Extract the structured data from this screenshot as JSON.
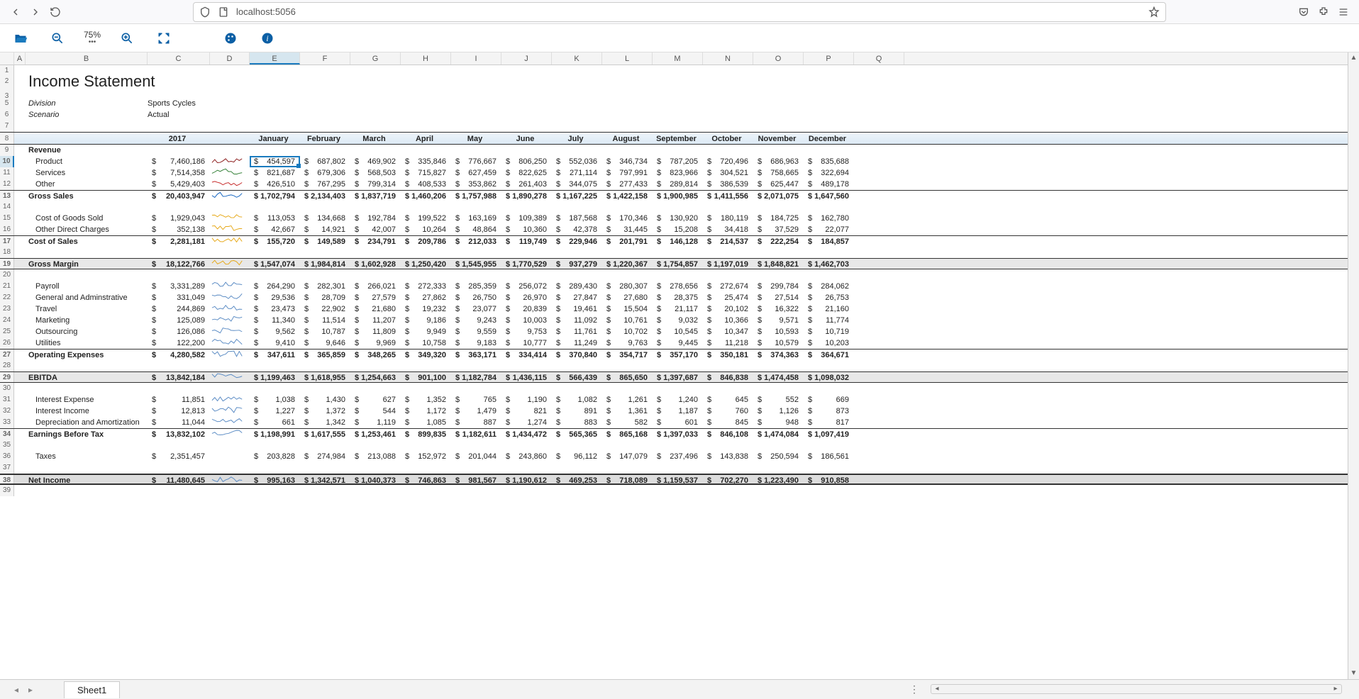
{
  "browser": {
    "url": "localhost:5056"
  },
  "toolbar": {
    "zoom": "75%"
  },
  "bottom": {
    "sheet": "Sheet1"
  },
  "columns_letters": [
    "A",
    "B",
    "C",
    "D",
    "E",
    "F",
    "G",
    "H",
    "I",
    "J",
    "K",
    "L",
    "M",
    "N",
    "O",
    "P",
    "Q"
  ],
  "row_nums": [
    "1",
    "2",
    "3",
    "5",
    "6",
    "7",
    "8",
    "9",
    "10",
    "11",
    "12",
    "13",
    "14",
    "15",
    "16",
    "17",
    "18",
    "19",
    "20",
    "21",
    "22",
    "23",
    "24",
    "25",
    "26",
    "27",
    "28",
    "29",
    "30",
    "31",
    "32",
    "33",
    "34",
    "35",
    "36",
    "37",
    "38",
    "39"
  ],
  "title": "Income Statement",
  "meta": {
    "division_label": "Division",
    "division_value": "Sports Cycles",
    "scenario_label": "Scenario",
    "scenario_value": "Actual"
  },
  "header": {
    "year": "2017",
    "months": [
      "January",
      "February",
      "March",
      "April",
      "May",
      "June",
      "July",
      "August",
      "September",
      "October",
      "November",
      "December"
    ]
  },
  "lines": {
    "revenue_hdr": "Revenue",
    "product": {
      "label": "Product",
      "total": "7,460,186",
      "m": [
        "454,597",
        "687,802",
        "469,902",
        "335,846",
        "776,667",
        "806,250",
        "552,036",
        "346,734",
        "787,205",
        "720,496",
        "686,963",
        "835,688"
      ]
    },
    "services": {
      "label": "Services",
      "total": "7,514,358",
      "m": [
        "821,687",
        "679,306",
        "568,503",
        "715,827",
        "627,459",
        "822,625",
        "271,114",
        "797,991",
        "823,966",
        "304,521",
        "758,665",
        "322,694"
      ]
    },
    "other": {
      "label": "Other",
      "total": "5,429,403",
      "m": [
        "426,510",
        "767,295",
        "799,314",
        "408,533",
        "353,862",
        "261,403",
        "344,075",
        "277,433",
        "289,814",
        "386,539",
        "625,447",
        "489,178"
      ]
    },
    "gross_sales": {
      "label": "Gross Sales",
      "total": "20,403,947",
      "m": [
        "1,702,794",
        "2,134,403",
        "1,837,719",
        "1,460,206",
        "1,757,988",
        "1,890,278",
        "1,167,225",
        "1,422,158",
        "1,900,985",
        "1,411,556",
        "2,071,075",
        "1,647,560"
      ]
    },
    "cogs": {
      "label": "Cost of Goods Sold",
      "total": "1,929,043",
      "m": [
        "113,053",
        "134,668",
        "192,784",
        "199,522",
        "163,169",
        "109,389",
        "187,568",
        "170,346",
        "130,920",
        "180,119",
        "184,725",
        "162,780"
      ]
    },
    "odc": {
      "label": "Other Direct Charges",
      "total": "352,138",
      "m": [
        "42,667",
        "14,921",
        "42,007",
        "10,264",
        "48,864",
        "10,360",
        "42,378",
        "31,445",
        "15,208",
        "34,418",
        "37,529",
        "22,077"
      ]
    },
    "cos": {
      "label": "Cost of Sales",
      "total": "2,281,181",
      "m": [
        "155,720",
        "149,589",
        "234,791",
        "209,786",
        "212,033",
        "119,749",
        "229,946",
        "201,791",
        "146,128",
        "214,537",
        "222,254",
        "184,857"
      ]
    },
    "gm": {
      "label": "Gross Margin",
      "total": "18,122,766",
      "m": [
        "1,547,074",
        "1,984,814",
        "1,602,928",
        "1,250,420",
        "1,545,955",
        "1,770,529",
        "937,279",
        "1,220,367",
        "1,754,857",
        "1,197,019",
        "1,848,821",
        "1,462,703"
      ]
    },
    "payroll": {
      "label": "Payroll",
      "total": "3,331,289",
      "m": [
        "264,290",
        "282,301",
        "266,021",
        "272,333",
        "285,359",
        "256,072",
        "289,430",
        "280,307",
        "278,656",
        "272,674",
        "299,784",
        "284,062"
      ]
    },
    "ga": {
      "label": "General and Adminstrative",
      "total": "331,049",
      "m": [
        "29,536",
        "28,709",
        "27,579",
        "27,862",
        "26,750",
        "26,970",
        "27,847",
        "27,680",
        "28,375",
        "25,474",
        "27,514",
        "26,753"
      ]
    },
    "travel": {
      "label": "Travel",
      "total": "244,869",
      "m": [
        "23,473",
        "22,902",
        "21,680",
        "19,232",
        "23,077",
        "20,839",
        "19,461",
        "15,504",
        "21,117",
        "20,102",
        "16,322",
        "21,160"
      ]
    },
    "mkt": {
      "label": "Marketing",
      "total": "125,089",
      "m": [
        "11,340",
        "11,514",
        "11,207",
        "9,186",
        "9,243",
        "10,003",
        "11,092",
        "10,761",
        "9,032",
        "10,366",
        "9,571",
        "11,774"
      ]
    },
    "out": {
      "label": "Outsourcing",
      "total": "126,086",
      "m": [
        "9,562",
        "10,787",
        "11,809",
        "9,949",
        "9,559",
        "9,753",
        "11,761",
        "10,702",
        "10,545",
        "10,347",
        "10,593",
        "10,719"
      ]
    },
    "util": {
      "label": "Utilities",
      "total": "122,200",
      "m": [
        "9,410",
        "9,646",
        "9,969",
        "10,758",
        "9,183",
        "10,777",
        "11,249",
        "9,763",
        "9,445",
        "11,218",
        "10,579",
        "10,203"
      ]
    },
    "opex": {
      "label": "Operating Expenses",
      "total": "4,280,582",
      "m": [
        "347,611",
        "365,859",
        "348,265",
        "349,320",
        "363,171",
        "334,414",
        "370,840",
        "354,717",
        "357,170",
        "350,181",
        "374,363",
        "364,671"
      ]
    },
    "ebitda": {
      "label": "EBITDA",
      "total": "13,842,184",
      "m": [
        "1,199,463",
        "1,618,955",
        "1,254,663",
        "901,100",
        "1,182,784",
        "1,436,115",
        "566,439",
        "865,650",
        "1,397,687",
        "846,838",
        "1,474,458",
        "1,098,032"
      ]
    },
    "intexp": {
      "label": "Interest Expense",
      "total": "11,851",
      "m": [
        "1,038",
        "1,430",
        "627",
        "1,352",
        "765",
        "1,190",
        "1,082",
        "1,261",
        "1,240",
        "645",
        "552",
        "669"
      ]
    },
    "intinc": {
      "label": "Interest Income",
      "total": "12,813",
      "m": [
        "1,227",
        "1,372",
        "544",
        "1,172",
        "1,479",
        "821",
        "891",
        "1,361",
        "1,187",
        "760",
        "1,126",
        "873"
      ]
    },
    "da": {
      "label": "Depreciation and Amortization",
      "total": "11,044",
      "m": [
        "661",
        "1,342",
        "1,119",
        "1,085",
        "887",
        "1,274",
        "883",
        "582",
        "601",
        "845",
        "948",
        "817"
      ]
    },
    "ebt": {
      "label": "Earnings Before Tax",
      "total": "13,832,102",
      "m": [
        "1,198,991",
        "1,617,555",
        "1,253,461",
        "899,835",
        "1,182,611",
        "1,434,472",
        "565,365",
        "865,168",
        "1,397,033",
        "846,108",
        "1,474,084",
        "1,097,419"
      ]
    },
    "tax": {
      "label": "Taxes",
      "total": "2,351,457",
      "m": [
        "203,828",
        "274,984",
        "213,088",
        "152,972",
        "201,044",
        "243,860",
        "96,112",
        "147,079",
        "237,496",
        "143,838",
        "250,594",
        "186,561"
      ]
    },
    "ni": {
      "label": "Net Income",
      "total": "11,480,645",
      "m": [
        "995,163",
        "1,342,571",
        "1,040,373",
        "746,863",
        "981,567",
        "1,190,612",
        "469,253",
        "718,089",
        "1,159,537",
        "702,270",
        "1,223,490",
        "910,858"
      ]
    }
  },
  "sparkline_colors": {
    "product": "#8b1a1a",
    "services": "#2e7d32",
    "other": "#c62828",
    "gross_sales": "#1565c0",
    "cogs": "#e6a817",
    "odc": "#e6a817",
    "cos": "#e6a817",
    "gm": "#e6a817",
    "default": "#5a8bc4"
  },
  "selected_cell": "E10"
}
